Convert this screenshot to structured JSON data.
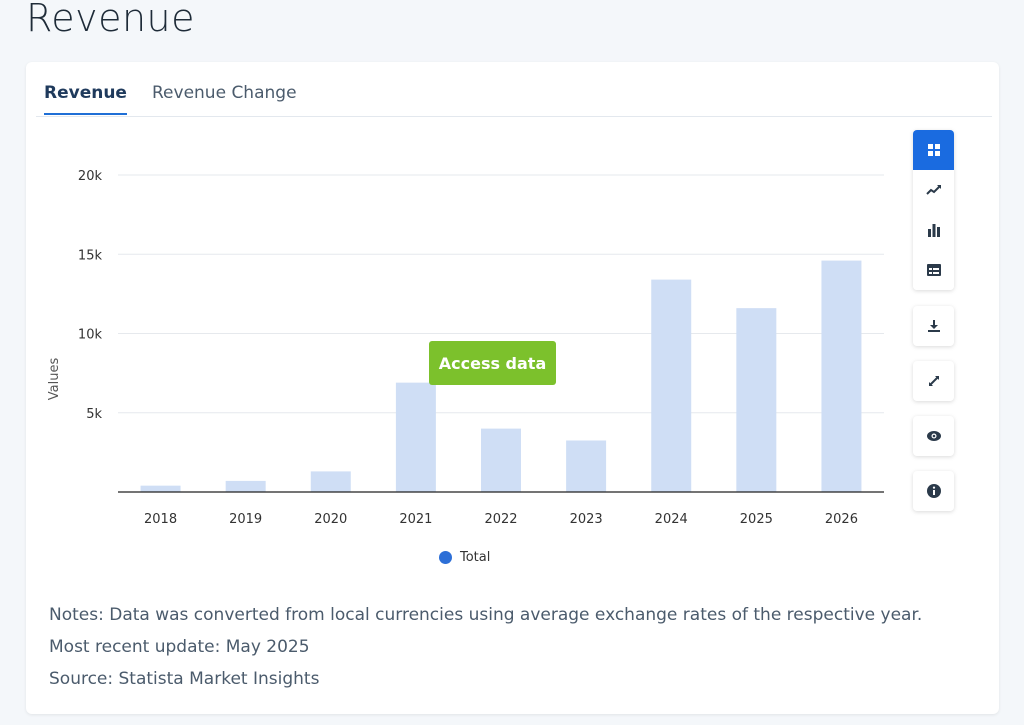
{
  "page": {
    "title": "Revenue"
  },
  "tabs": [
    {
      "label": "Revenue",
      "active": true
    },
    {
      "label": "Revenue Change",
      "active": false
    }
  ],
  "chart_data": {
    "type": "bar",
    "categories": [
      "2018",
      "2019",
      "2020",
      "2021",
      "2022",
      "2023",
      "2024",
      "2025",
      "2026"
    ],
    "series": [
      {
        "name": "Total",
        "values": [
          400,
          700,
          1300,
          6900,
          4000,
          3250,
          13400,
          11600,
          14600
        ]
      }
    ],
    "ylabel": "Values",
    "ylim": [
      0,
      20000
    ],
    "yticks": [
      5000,
      10000,
      15000,
      20000
    ],
    "ytick_labels": [
      "5k",
      "10k",
      "15k",
      "20k"
    ],
    "grid": true,
    "legend_position": "bottom",
    "bar_color": "#cfdef5",
    "legend_color": "#2d6fd7"
  },
  "access_button": {
    "label": "Access data",
    "color": "#7cc12c"
  },
  "toolbar": {
    "items": [
      "grid-icon",
      "line-chart-icon",
      "bar-chart-icon",
      "table-icon",
      "download-icon",
      "expand-icon",
      "eye-icon",
      "info-icon"
    ],
    "active_color": "#1a6be0"
  },
  "notes": {
    "notes": "Notes: Data was converted from local currencies using average exchange rates of the respective year.",
    "update": "Most recent update: May 2025",
    "source": "Source: Statista Market Insights"
  }
}
